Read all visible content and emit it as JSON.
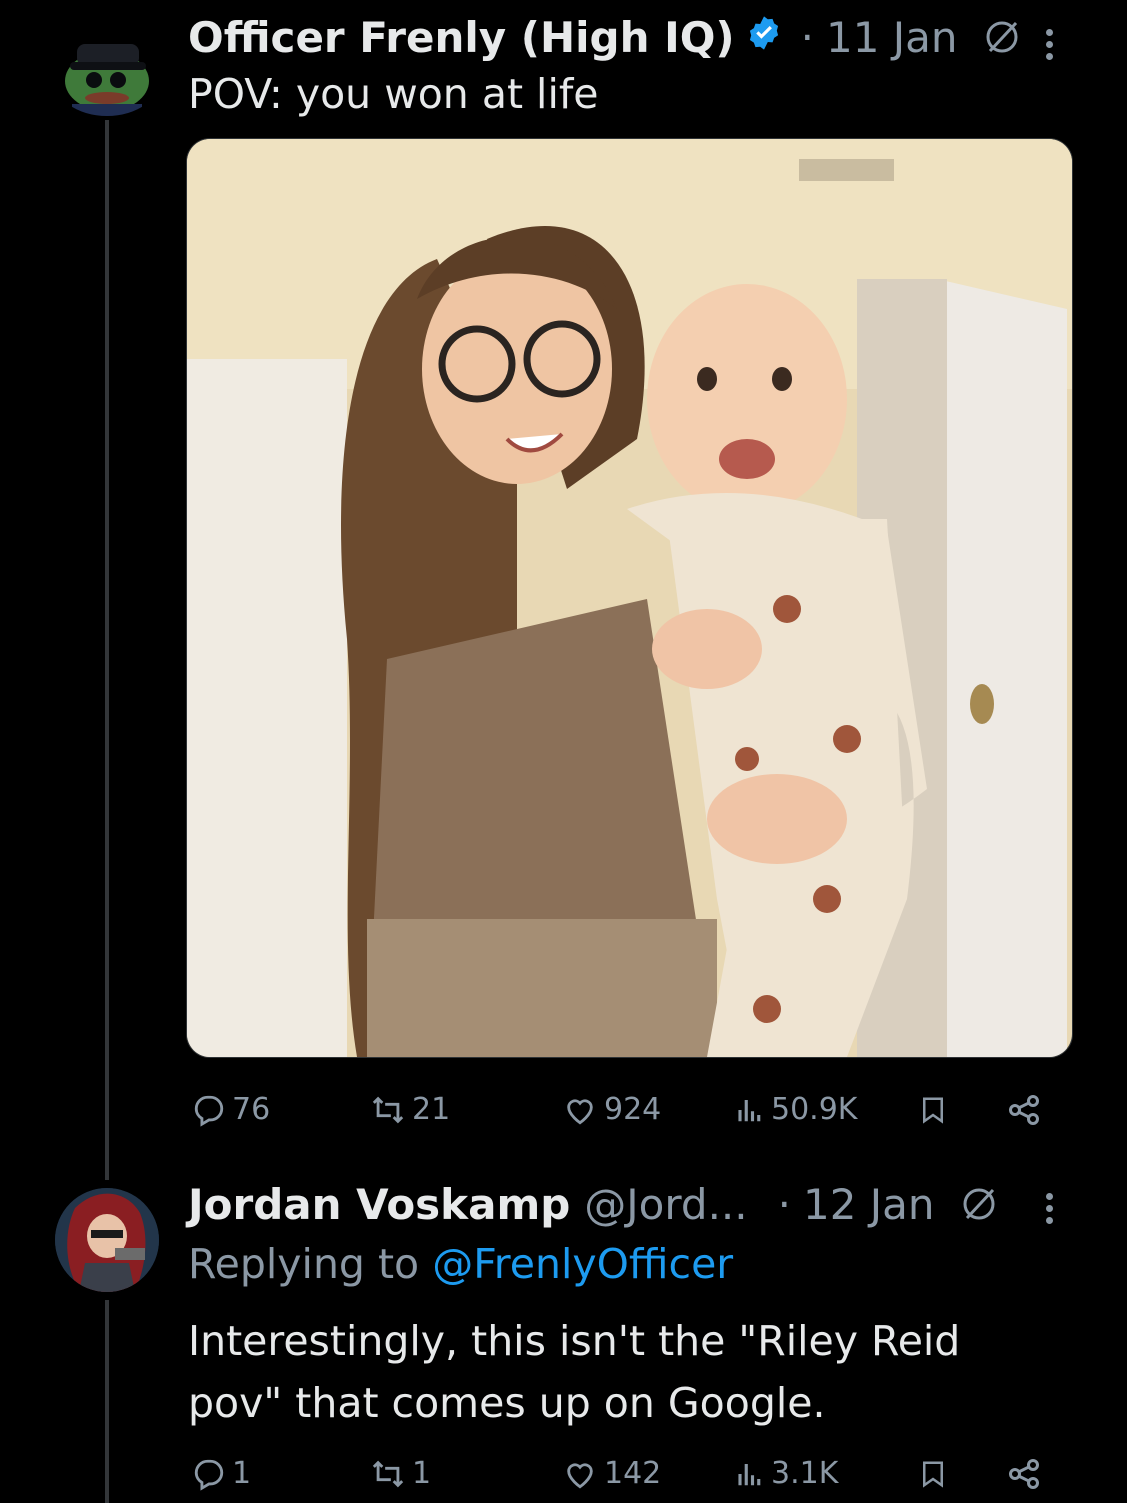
{
  "tweets": [
    {
      "display_name": "Officer Frenly (High IQ)",
      "separator": "·",
      "date": "11 Jan",
      "text": "POV: you won at life",
      "verified_color": "#1d9bf0",
      "stats": {
        "replies": "76",
        "reposts": "21",
        "likes": "924",
        "views": "50.9K"
      }
    },
    {
      "display_name": "Jordan Voskamp",
      "handle": "@Jord...",
      "separator": "·",
      "date": "12 Jan",
      "replying_prefix": "Replying to",
      "replying_handle": "@FrenlyOfficer",
      "text_line1": "Interestingly, this isn't the \"Riley Reid",
      "text_line2": "pov\" that comes up on Google.",
      "stats": {
        "replies": "1",
        "reposts": "1",
        "likes": "142",
        "views": "3.1K"
      }
    }
  ],
  "icons": {
    "reply": "reply-icon",
    "repost": "repost-icon",
    "like": "heart-icon",
    "views": "views-icon",
    "bookmark": "bookmark-icon",
    "share": "share-icon",
    "mute": "mute-icon",
    "more": "more-icon",
    "verified": "verified-badge-icon"
  },
  "colors": {
    "background": "#000000",
    "text": "#e7e9ea",
    "muted": "#8b98a5",
    "link": "#1d9bf0"
  }
}
